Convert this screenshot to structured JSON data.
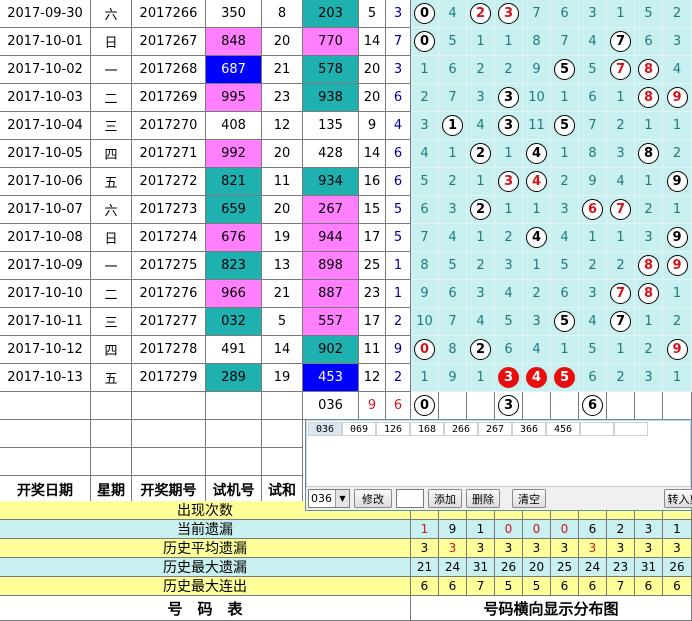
{
  "rows": [
    {
      "date": "2017-09-30",
      "weekday": "六",
      "issue": "2017266",
      "trial": "350",
      "trial_sum": "8",
      "draw": "203",
      "span": "5",
      "tail": "3",
      "dist": [
        "0",
        "4",
        "2",
        "3",
        "7",
        "6",
        "3",
        "1",
        "5",
        "2"
      ],
      "balls": {
        "0": "blk",
        "2": "red",
        "3": "red"
      },
      "trial_bg": "#ffffff",
      "draw_bg": "#1fb0b0"
    },
    {
      "date": "2017-10-01",
      "weekday": "日",
      "issue": "2017267",
      "trial": "848",
      "trial_sum": "20",
      "draw": "770",
      "span": "14",
      "tail": "7",
      "dist": [
        "0",
        "5",
        "1",
        "1",
        "8",
        "7",
        "4",
        "7",
        "6",
        "3"
      ],
      "balls": {
        "0": "blk",
        "7": "blk"
      },
      "trial_bg": "#ff7fff",
      "draw_bg": "#ff7fff"
    },
    {
      "date": "2017-10-02",
      "weekday": "一",
      "issue": "2017268",
      "trial": "687",
      "trial_sum": "21",
      "draw": "578",
      "span": "20",
      "tail": "3",
      "dist": [
        "1",
        "6",
        "2",
        "2",
        "9",
        "5",
        "5",
        "7",
        "8",
        "4"
      ],
      "balls": {
        "5": "blk",
        "7": "red",
        "8": "red"
      },
      "trial_bg": "#0000ff",
      "draw_bg": "#1fb0b0"
    },
    {
      "date": "2017-10-03",
      "weekday": "二",
      "issue": "2017269",
      "trial": "995",
      "trial_sum": "23",
      "draw": "938",
      "span": "20",
      "tail": "6",
      "dist": [
        "2",
        "7",
        "3",
        "3",
        "10",
        "1",
        "6",
        "1",
        "8",
        "9"
      ],
      "balls": {
        "3": "blk",
        "8": "red",
        "9": "red"
      },
      "trial_bg": "#ff7fff",
      "draw_bg": "#1fb0b0"
    },
    {
      "date": "2017-10-04",
      "weekday": "三",
      "issue": "2017270",
      "trial": "408",
      "trial_sum": "12",
      "draw": "135",
      "span": "9",
      "tail": "4",
      "dist": [
        "3",
        "1",
        "4",
        "3",
        "11",
        "5",
        "7",
        "2",
        "1",
        "1"
      ],
      "balls": {
        "1": "blk",
        "3": "blk",
        "5": "blk"
      },
      "trial_bg": "#ffffff",
      "draw_bg": "#ffffff"
    },
    {
      "date": "2017-10-05",
      "weekday": "四",
      "issue": "2017271",
      "trial": "992",
      "trial_sum": "20",
      "draw": "428",
      "span": "14",
      "tail": "6",
      "dist": [
        "4",
        "1",
        "2",
        "1",
        "4",
        "1",
        "8",
        "3",
        "8",
        "2"
      ],
      "balls": {
        "2": "blk",
        "4": "blk",
        "8": "blk"
      },
      "trial_bg": "#ff7fff",
      "draw_bg": "#ffffff"
    },
    {
      "date": "2017-10-06",
      "weekday": "五",
      "issue": "2017272",
      "trial": "821",
      "trial_sum": "11",
      "draw": "934",
      "span": "16",
      "tail": "6",
      "dist": [
        "5",
        "2",
        "1",
        "3",
        "4",
        "2",
        "9",
        "4",
        "1",
        "9"
      ],
      "balls": {
        "3": "red",
        "4": "red",
        "9": "blk"
      },
      "trial_bg": "#1fb0b0",
      "draw_bg": "#1fb0b0"
    },
    {
      "date": "2017-10-07",
      "weekday": "六",
      "issue": "2017273",
      "trial": "659",
      "trial_sum": "20",
      "draw": "267",
      "span": "15",
      "tail": "5",
      "dist": [
        "6",
        "3",
        "2",
        "1",
        "1",
        "3",
        "6",
        "7",
        "2",
        "1"
      ],
      "balls": {
        "2": "blk",
        "6": "red",
        "7": "red"
      },
      "trial_bg": "#1fb0b0",
      "draw_bg": "#ff7fff"
    },
    {
      "date": "2017-10-08",
      "weekday": "日",
      "issue": "2017274",
      "trial": "676",
      "trial_sum": "19",
      "draw": "944",
      "span": "17",
      "tail": "5",
      "dist": [
        "7",
        "4",
        "1",
        "2",
        "4",
        "4",
        "1",
        "1",
        "3",
        "9"
      ],
      "balls": {
        "4": "blk",
        "9": "blk"
      },
      "trial_bg": "#ff7fff",
      "draw_bg": "#ff7fff"
    },
    {
      "date": "2017-10-09",
      "weekday": "一",
      "issue": "2017275",
      "trial": "823",
      "trial_sum": "13",
      "draw": "898",
      "span": "25",
      "tail": "1",
      "dist": [
        "8",
        "5",
        "2",
        "3",
        "1",
        "5",
        "2",
        "2",
        "8",
        "9"
      ],
      "balls": {
        "8": "red",
        "9": "red"
      },
      "trial_bg": "#1fb0b0",
      "draw_bg": "#ff7fff"
    },
    {
      "date": "2017-10-10",
      "weekday": "二",
      "issue": "2017276",
      "trial": "966",
      "trial_sum": "21",
      "draw": "887",
      "span": "23",
      "tail": "1",
      "dist": [
        "9",
        "6",
        "3",
        "4",
        "2",
        "6",
        "3",
        "7",
        "8",
        "1"
      ],
      "balls": {
        "7": "red",
        "8": "red"
      },
      "trial_bg": "#ff7fff",
      "draw_bg": "#ff7fff"
    },
    {
      "date": "2017-10-11",
      "weekday": "三",
      "issue": "2017277",
      "trial": "032",
      "trial_sum": "5",
      "draw": "557",
      "span": "17",
      "tail": "2",
      "dist": [
        "10",
        "7",
        "4",
        "5",
        "3",
        "5",
        "4",
        "7",
        "1",
        "2"
      ],
      "balls": {
        "5": "blk",
        "7": "blk"
      },
      "trial_bg": "#1fb0b0",
      "draw_bg": "#ff7fff"
    },
    {
      "date": "2017-10-12",
      "weekday": "四",
      "issue": "2017278",
      "trial": "491",
      "trial_sum": "14",
      "draw": "902",
      "span": "11",
      "tail": "9",
      "dist": [
        "0",
        "8",
        "2",
        "6",
        "4",
        "1",
        "5",
        "1",
        "2",
        "9"
      ],
      "balls": {
        "0": "red",
        "2": "blk",
        "9": "red"
      },
      "trial_bg": "#ffffff",
      "draw_bg": "#1fb0b0"
    },
    {
      "date": "2017-10-13",
      "weekday": "五",
      "issue": "2017279",
      "trial": "289",
      "trial_sum": "19",
      "draw": "453",
      "span": "12",
      "tail": "2",
      "dist": [
        "1",
        "9",
        "1",
        "3",
        "4",
        "5",
        "6",
        "2",
        "3",
        "1"
      ],
      "balls": {
        "3": "solid",
        "4": "solid",
        "5": "solid"
      },
      "trial_bg": "#1fb0b0",
      "draw_bg": "#0000ff"
    }
  ],
  "pending": {
    "draw": "036",
    "span": "9",
    "tail": "6",
    "balls": [
      "0",
      "3",
      "6"
    ]
  },
  "headers": {
    "date": "开奖日期",
    "weekday": "星期",
    "issue": "开奖期号",
    "trial": "试机号",
    "trial_sum": "试和"
  },
  "stats": [
    {
      "label": "出现次数",
      "values": [
        "",
        "",
        "",
        "",
        "",
        "",
        "",
        "",
        "",
        ""
      ],
      "bg": "#ffff99"
    },
    {
      "label": "当前遗漏",
      "values": [
        "1",
        "9",
        "1",
        "0",
        "0",
        "0",
        "6",
        "2",
        "3",
        "1"
      ],
      "bg": "#c8f0f0"
    },
    {
      "label": "历史平均遗漏",
      "values": [
        "3",
        "3",
        "3",
        "3",
        "3",
        "3",
        "3",
        "3",
        "3",
        "3"
      ],
      "bg": "#ffff99"
    },
    {
      "label": "历史最大遗漏",
      "values": [
        "21",
        "24",
        "31",
        "26",
        "20",
        "25",
        "24",
        "23",
        "31",
        "26"
      ],
      "bg": "#c8f0f0"
    },
    {
      "label": "历史最大连出",
      "values": [
        "6",
        "6",
        "7",
        "5",
        "5",
        "6",
        "6",
        "7",
        "6",
        "6"
      ],
      "bg": "#ffff99"
    }
  ],
  "footer": {
    "left": "号　码　表",
    "right": "号码横向显示分布图"
  },
  "popup": {
    "tabs": [
      "036",
      "069",
      "126",
      "168",
      "266",
      "267",
      "366",
      "456",
      "",
      ""
    ],
    "select_value": "036",
    "modify_label": "修改",
    "add_label": "添加",
    "delete_label": "删除",
    "clear_label": "清空",
    "import_label": "转入剪"
  },
  "colors": {
    "cyan": "#1fb0b0",
    "magenta": "#ff7fff",
    "blue": "#0000ff",
    "dist_text": "#1f7a7a",
    "ball_red": "#d4141c"
  }
}
